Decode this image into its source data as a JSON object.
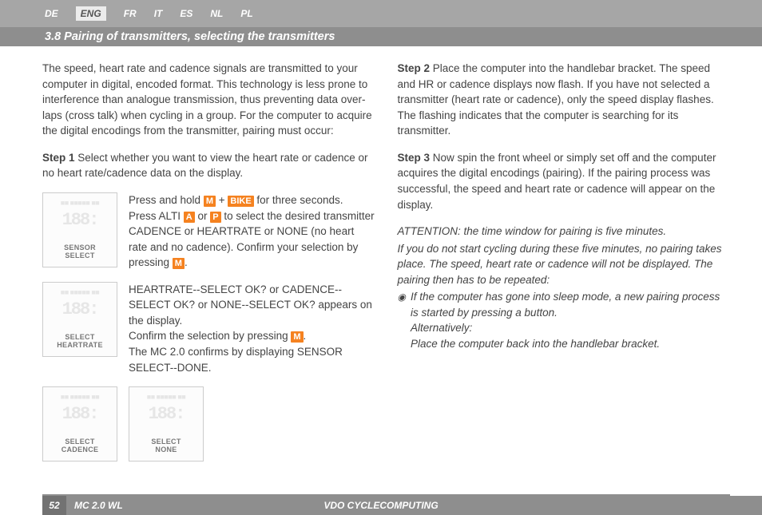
{
  "lang_tabs": {
    "de": "DE",
    "eng": "ENG",
    "fr": "FR",
    "it": "IT",
    "es": "ES",
    "nl": "NL",
    "pl": "PL"
  },
  "section_title": "3.8 Pairing of transmitters, selecting the transmitters",
  "left": {
    "intro": "The speed, heart rate and cadence signals are transmitted to your computer in digital, encoded format. This technology is less prone to interference than analogue transmission, thus preventing data over­laps (cross talk) when cycling in a group. For the computer to acquire the digital encodings from the transmitter, pairing must occur:",
    "step1_label": "Step 1",
    "step1_text": " Select whether you want to view the heart rate or cadence or no heart rate/cadence data on the display.",
    "fig1_label": "SENSOR\nSELECT",
    "block1_a": "Press and hold ",
    "m": "M",
    "plus": " + ",
    "bike": "BIKE",
    "block1_b": " for three seconds.",
    "block1_c": "Press ALTI ",
    "a": "A",
    "or": " or ",
    "p": "P",
    "block1_d": " to select the desired transmitter CADENCE or HEARTRATE or NONE (no heart rate and no cadence). Confirm your selection by pressing ",
    "block1_e": ".",
    "fig2_label": "SELECT\nHEARTRATE",
    "block2_a": "HEARTRATE--SELECT OK? or  CADENCE--SELECT OK? or NONE--SELECT OK? appears on the display.",
    "block2_b": "Confirm the selection by pressing ",
    "block2_c": ".",
    "block2_d": "The MC 2.0 confirms by displaying SENSOR SELECT--DONE.",
    "fig3_label": "SELECT\nCADENCE",
    "fig4_label": "SELECT\nNONE"
  },
  "right": {
    "step2_label": "Step 2",
    "step2_text": " Place the computer into the handlebar bracket. The speed and HR or cadence displays now flash. If you have not selected a transmitter (heart rate or cadence), only the speed display flashes. The flashing indicates that the computer is searching for its transmitter.",
    "step3_label": "Step 3",
    "step3_text": " Now spin the front wheel or simply set off and the computer acquires the digital encodings (pairing). If the pairing process was successful, the speed and heart rate or cadence will appear on the display.",
    "att1": "ATTENTION: the time window for pairing is five minutes.",
    "att2": "If you do not start cycling during these five minutes, no pairing takes place. The speed, heart rate or cadence will not be displayed. The pairing then has to be repeated:",
    "bul1": "If the computer has gone into sleep mode, a new pairing process is started by pressing a button.",
    "bul2": "Alternatively:",
    "bul3": "Place the computer back into the handlebar bracket."
  },
  "footer": {
    "page": "52",
    "model": "MC 2.0 WL",
    "brand": "VDO CYCLECOMPUTING"
  },
  "ghost": {
    "top": "■■ ■■■■■ ■■",
    "seg": "188:"
  }
}
